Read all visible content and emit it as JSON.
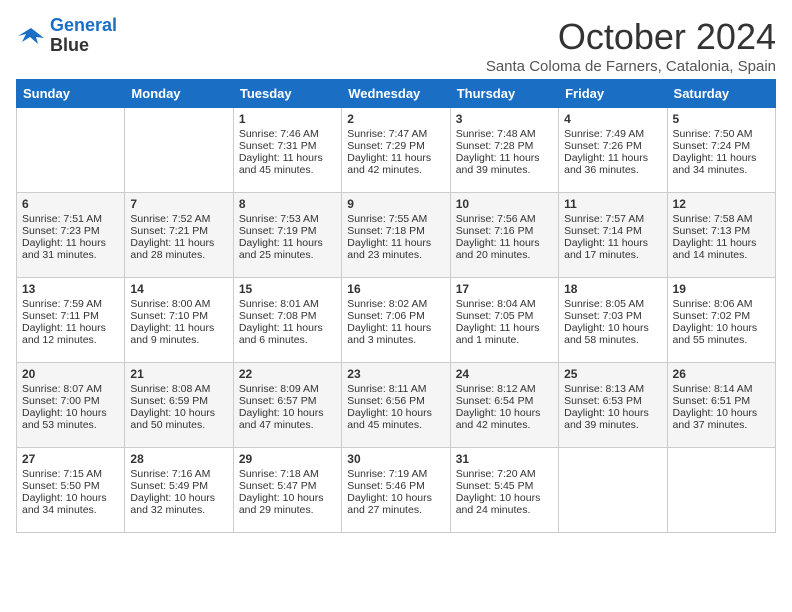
{
  "logo": {
    "line1": "General",
    "line2": "Blue"
  },
  "title": "October 2024",
  "subtitle": "Santa Coloma de Farners, Catalonia, Spain",
  "weekdays": [
    "Sunday",
    "Monday",
    "Tuesday",
    "Wednesday",
    "Thursday",
    "Friday",
    "Saturday"
  ],
  "weeks": [
    [
      {
        "day": "",
        "sunrise": "",
        "sunset": "",
        "daylight": ""
      },
      {
        "day": "",
        "sunrise": "",
        "sunset": "",
        "daylight": ""
      },
      {
        "day": "1",
        "sunrise": "Sunrise: 7:46 AM",
        "sunset": "Sunset: 7:31 PM",
        "daylight": "Daylight: 11 hours and 45 minutes."
      },
      {
        "day": "2",
        "sunrise": "Sunrise: 7:47 AM",
        "sunset": "Sunset: 7:29 PM",
        "daylight": "Daylight: 11 hours and 42 minutes."
      },
      {
        "day": "3",
        "sunrise": "Sunrise: 7:48 AM",
        "sunset": "Sunset: 7:28 PM",
        "daylight": "Daylight: 11 hours and 39 minutes."
      },
      {
        "day": "4",
        "sunrise": "Sunrise: 7:49 AM",
        "sunset": "Sunset: 7:26 PM",
        "daylight": "Daylight: 11 hours and 36 minutes."
      },
      {
        "day": "5",
        "sunrise": "Sunrise: 7:50 AM",
        "sunset": "Sunset: 7:24 PM",
        "daylight": "Daylight: 11 hours and 34 minutes."
      }
    ],
    [
      {
        "day": "6",
        "sunrise": "Sunrise: 7:51 AM",
        "sunset": "Sunset: 7:23 PM",
        "daylight": "Daylight: 11 hours and 31 minutes."
      },
      {
        "day": "7",
        "sunrise": "Sunrise: 7:52 AM",
        "sunset": "Sunset: 7:21 PM",
        "daylight": "Daylight: 11 hours and 28 minutes."
      },
      {
        "day": "8",
        "sunrise": "Sunrise: 7:53 AM",
        "sunset": "Sunset: 7:19 PM",
        "daylight": "Daylight: 11 hours and 25 minutes."
      },
      {
        "day": "9",
        "sunrise": "Sunrise: 7:55 AM",
        "sunset": "Sunset: 7:18 PM",
        "daylight": "Daylight: 11 hours and 23 minutes."
      },
      {
        "day": "10",
        "sunrise": "Sunrise: 7:56 AM",
        "sunset": "Sunset: 7:16 PM",
        "daylight": "Daylight: 11 hours and 20 minutes."
      },
      {
        "day": "11",
        "sunrise": "Sunrise: 7:57 AM",
        "sunset": "Sunset: 7:14 PM",
        "daylight": "Daylight: 11 hours and 17 minutes."
      },
      {
        "day": "12",
        "sunrise": "Sunrise: 7:58 AM",
        "sunset": "Sunset: 7:13 PM",
        "daylight": "Daylight: 11 hours and 14 minutes."
      }
    ],
    [
      {
        "day": "13",
        "sunrise": "Sunrise: 7:59 AM",
        "sunset": "Sunset: 7:11 PM",
        "daylight": "Daylight: 11 hours and 12 minutes."
      },
      {
        "day": "14",
        "sunrise": "Sunrise: 8:00 AM",
        "sunset": "Sunset: 7:10 PM",
        "daylight": "Daylight: 11 hours and 9 minutes."
      },
      {
        "day": "15",
        "sunrise": "Sunrise: 8:01 AM",
        "sunset": "Sunset: 7:08 PM",
        "daylight": "Daylight: 11 hours and 6 minutes."
      },
      {
        "day": "16",
        "sunrise": "Sunrise: 8:02 AM",
        "sunset": "Sunset: 7:06 PM",
        "daylight": "Daylight: 11 hours and 3 minutes."
      },
      {
        "day": "17",
        "sunrise": "Sunrise: 8:04 AM",
        "sunset": "Sunset: 7:05 PM",
        "daylight": "Daylight: 11 hours and 1 minute."
      },
      {
        "day": "18",
        "sunrise": "Sunrise: 8:05 AM",
        "sunset": "Sunset: 7:03 PM",
        "daylight": "Daylight: 10 hours and 58 minutes."
      },
      {
        "day": "19",
        "sunrise": "Sunrise: 8:06 AM",
        "sunset": "Sunset: 7:02 PM",
        "daylight": "Daylight: 10 hours and 55 minutes."
      }
    ],
    [
      {
        "day": "20",
        "sunrise": "Sunrise: 8:07 AM",
        "sunset": "Sunset: 7:00 PM",
        "daylight": "Daylight: 10 hours and 53 minutes."
      },
      {
        "day": "21",
        "sunrise": "Sunrise: 8:08 AM",
        "sunset": "Sunset: 6:59 PM",
        "daylight": "Daylight: 10 hours and 50 minutes."
      },
      {
        "day": "22",
        "sunrise": "Sunrise: 8:09 AM",
        "sunset": "Sunset: 6:57 PM",
        "daylight": "Daylight: 10 hours and 47 minutes."
      },
      {
        "day": "23",
        "sunrise": "Sunrise: 8:11 AM",
        "sunset": "Sunset: 6:56 PM",
        "daylight": "Daylight: 10 hours and 45 minutes."
      },
      {
        "day": "24",
        "sunrise": "Sunrise: 8:12 AM",
        "sunset": "Sunset: 6:54 PM",
        "daylight": "Daylight: 10 hours and 42 minutes."
      },
      {
        "day": "25",
        "sunrise": "Sunrise: 8:13 AM",
        "sunset": "Sunset: 6:53 PM",
        "daylight": "Daylight: 10 hours and 39 minutes."
      },
      {
        "day": "26",
        "sunrise": "Sunrise: 8:14 AM",
        "sunset": "Sunset: 6:51 PM",
        "daylight": "Daylight: 10 hours and 37 minutes."
      }
    ],
    [
      {
        "day": "27",
        "sunrise": "Sunrise: 7:15 AM",
        "sunset": "Sunset: 5:50 PM",
        "daylight": "Daylight: 10 hours and 34 minutes."
      },
      {
        "day": "28",
        "sunrise": "Sunrise: 7:16 AM",
        "sunset": "Sunset: 5:49 PM",
        "daylight": "Daylight: 10 hours and 32 minutes."
      },
      {
        "day": "29",
        "sunrise": "Sunrise: 7:18 AM",
        "sunset": "Sunset: 5:47 PM",
        "daylight": "Daylight: 10 hours and 29 minutes."
      },
      {
        "day": "30",
        "sunrise": "Sunrise: 7:19 AM",
        "sunset": "Sunset: 5:46 PM",
        "daylight": "Daylight: 10 hours and 27 minutes."
      },
      {
        "day": "31",
        "sunrise": "Sunrise: 7:20 AM",
        "sunset": "Sunset: 5:45 PM",
        "daylight": "Daylight: 10 hours and 24 minutes."
      },
      {
        "day": "",
        "sunrise": "",
        "sunset": "",
        "daylight": ""
      },
      {
        "day": "",
        "sunrise": "",
        "sunset": "",
        "daylight": ""
      }
    ]
  ]
}
